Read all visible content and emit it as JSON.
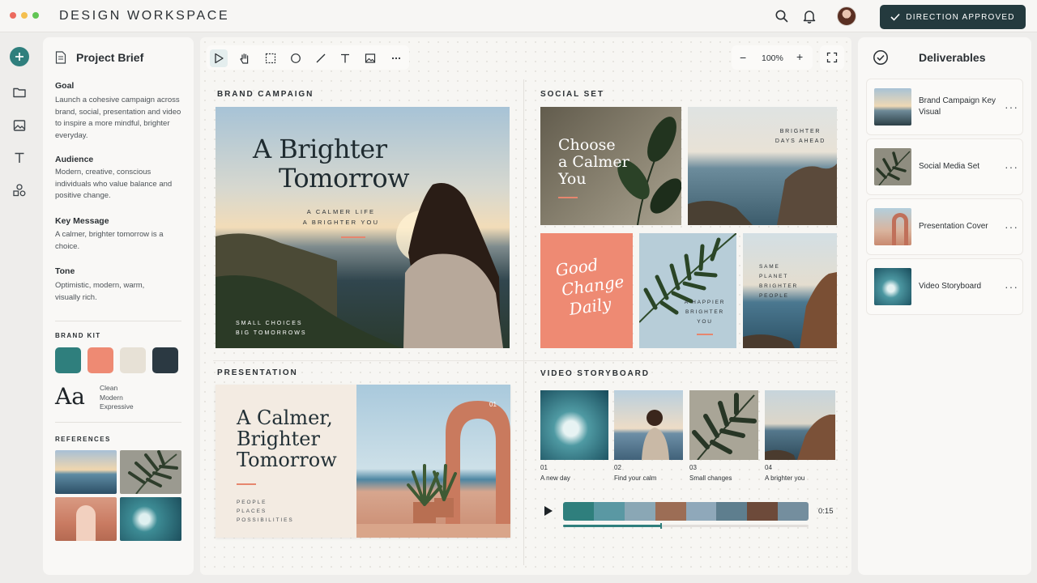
{
  "window": {
    "title": "DESIGN WORKSPACE",
    "controls": [
      "close",
      "minimize",
      "maximize"
    ],
    "colors": {
      "close": "#ec6a5e",
      "minimize": "#f4bf4f",
      "maximize": "#61c554"
    }
  },
  "header": {
    "icons": [
      "search-icon",
      "bell-icon",
      "avatar"
    ],
    "approve_label": "DIRECTION APPROVED",
    "approve_color": "#243a3e"
  },
  "rail": {
    "items": [
      "add-icon",
      "folder-icon",
      "image-icon",
      "text-icon",
      "shapes-icon"
    ],
    "accent": "#2f7f7d"
  },
  "brief": {
    "title": "Project Brief",
    "sections": [
      {
        "heading": "Goal",
        "text": "Launch a cohesive campaign across brand, social, presentation and video to inspire a more mindful, brighter everyday."
      },
      {
        "heading": "Audience",
        "text": "Modern, creative, conscious individuals who value balance and positive change."
      },
      {
        "heading": "Key Message",
        "text": "A calmer, brighter tomorrow is a choice."
      },
      {
        "heading": "Tone",
        "text": "Optimistic, modern, warm, visually rich."
      }
    ],
    "brand_kit": {
      "heading": "BRAND KIT",
      "swatches": [
        "#2f7f7d",
        "#ee8a73",
        "#e7e1d6",
        "#2b3942"
      ],
      "type_sample": "Aa",
      "type_words": [
        "Clean",
        "Modern",
        "Expressive"
      ]
    },
    "references": {
      "heading": "REFERENCES",
      "items": [
        "sunset-sea",
        "palm-leaf",
        "terracotta-arch",
        "ocean-wave"
      ]
    }
  },
  "canvas": {
    "tools": [
      "select-icon",
      "hand-icon",
      "marquee-icon",
      "ellipse-icon",
      "line-icon",
      "text-tool-icon",
      "image-tool-icon",
      "more-icon"
    ],
    "zoom": "100%",
    "zoom_out": "−",
    "zoom_in": "+",
    "brand_campaign": {
      "label": "BRAND CAMPAIGN",
      "headline_line1": "A Brighter",
      "headline_line2": "Tomorrow",
      "tagline_line1": "A CALMER LIFE",
      "tagline_line2": "A BRIGHTER YOU",
      "footer_line1": "SMALL CHOICES",
      "footer_line2": "BIG TOMORROWS"
    },
    "social_set": {
      "label": "SOCIAL SET",
      "post1_line1": "Choose",
      "post1_line2": "a Calmer",
      "post1_line3": "You",
      "post2_line1": "BRIGHTER",
      "post2_line2": "DAYS AHEAD",
      "post3_line1": "Good",
      "post3_line2": "Change",
      "post3_line3": "Daily",
      "post4_line1": "A HAPPIER",
      "post4_line2": "BRIGHTER",
      "post4_line3": "YOU",
      "post5_line1": "SAME",
      "post5_line2": "PLANET",
      "post5_line3": "BRIGHTER",
      "post5_line4": "PEOPLE"
    },
    "presentation": {
      "label": "PRESENTATION",
      "headline_line1": "A Calmer,",
      "headline_line2": "Brighter",
      "headline_line3": "Tomorrow",
      "sub_line1": "PEOPLE",
      "sub_line2": "PLACES",
      "sub_line3": "POSSIBILITIES",
      "slide_number": "01"
    },
    "video_storyboard": {
      "label": "VIDEO STORYBOARD",
      "frames": [
        {
          "num": "01",
          "caption": "A new day"
        },
        {
          "num": "02",
          "caption": "Find your calm"
        },
        {
          "num": "03",
          "caption": "Small changes"
        },
        {
          "num": "04",
          "caption": "A brighter you"
        }
      ],
      "duration": "0:15",
      "progress": 0.4
    }
  },
  "deliverables": {
    "title": "Deliverables",
    "items": [
      {
        "label": "Brand Campaign Key Visual"
      },
      {
        "label": "Social Media Set"
      },
      {
        "label": "Presentation Cover"
      },
      {
        "label": "Video Storyboard"
      }
    ],
    "more": "···"
  }
}
